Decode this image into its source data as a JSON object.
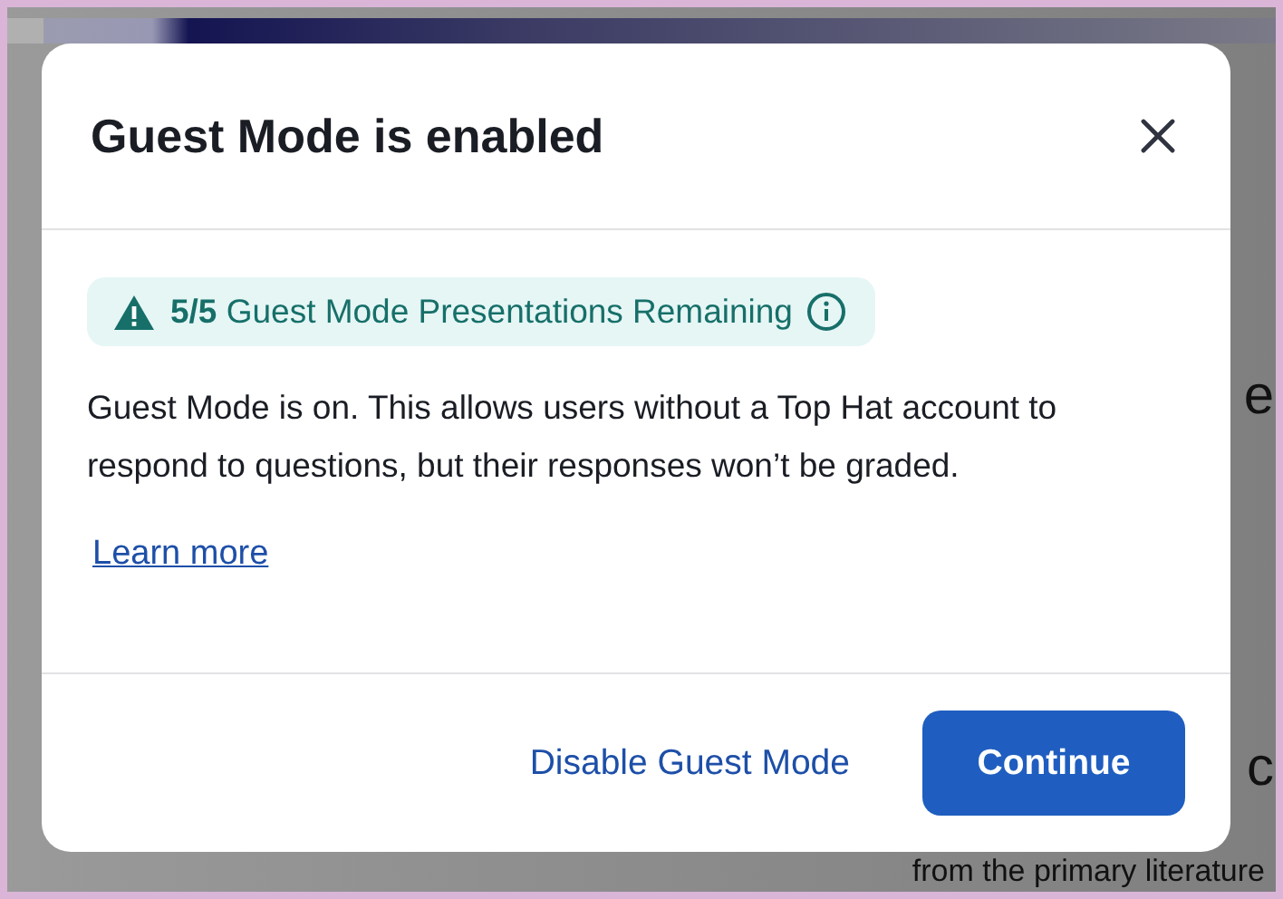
{
  "background": {
    "lines": [
      {
        "text": "e",
        "kind": "right"
      },
      {
        "text": "c",
        "kind": "right"
      },
      {
        "text": "from the primary literature",
        "kind": "bottom"
      }
    ]
  },
  "dialog": {
    "title": "Guest Mode is enabled",
    "notice": "**5/5** Guest Mode Presentations Remaining",
    "message": "Guest Mode is on. This allows users without a Top Hat account to respond to questions, but their responses won’t be graded.",
    "link": "Learn more",
    "buttons": [
      {
        "label": "Disable Guest Mode",
        "kind": "link"
      },
      {
        "label": "Continue",
        "kind": "primary"
      }
    ]
  }
}
